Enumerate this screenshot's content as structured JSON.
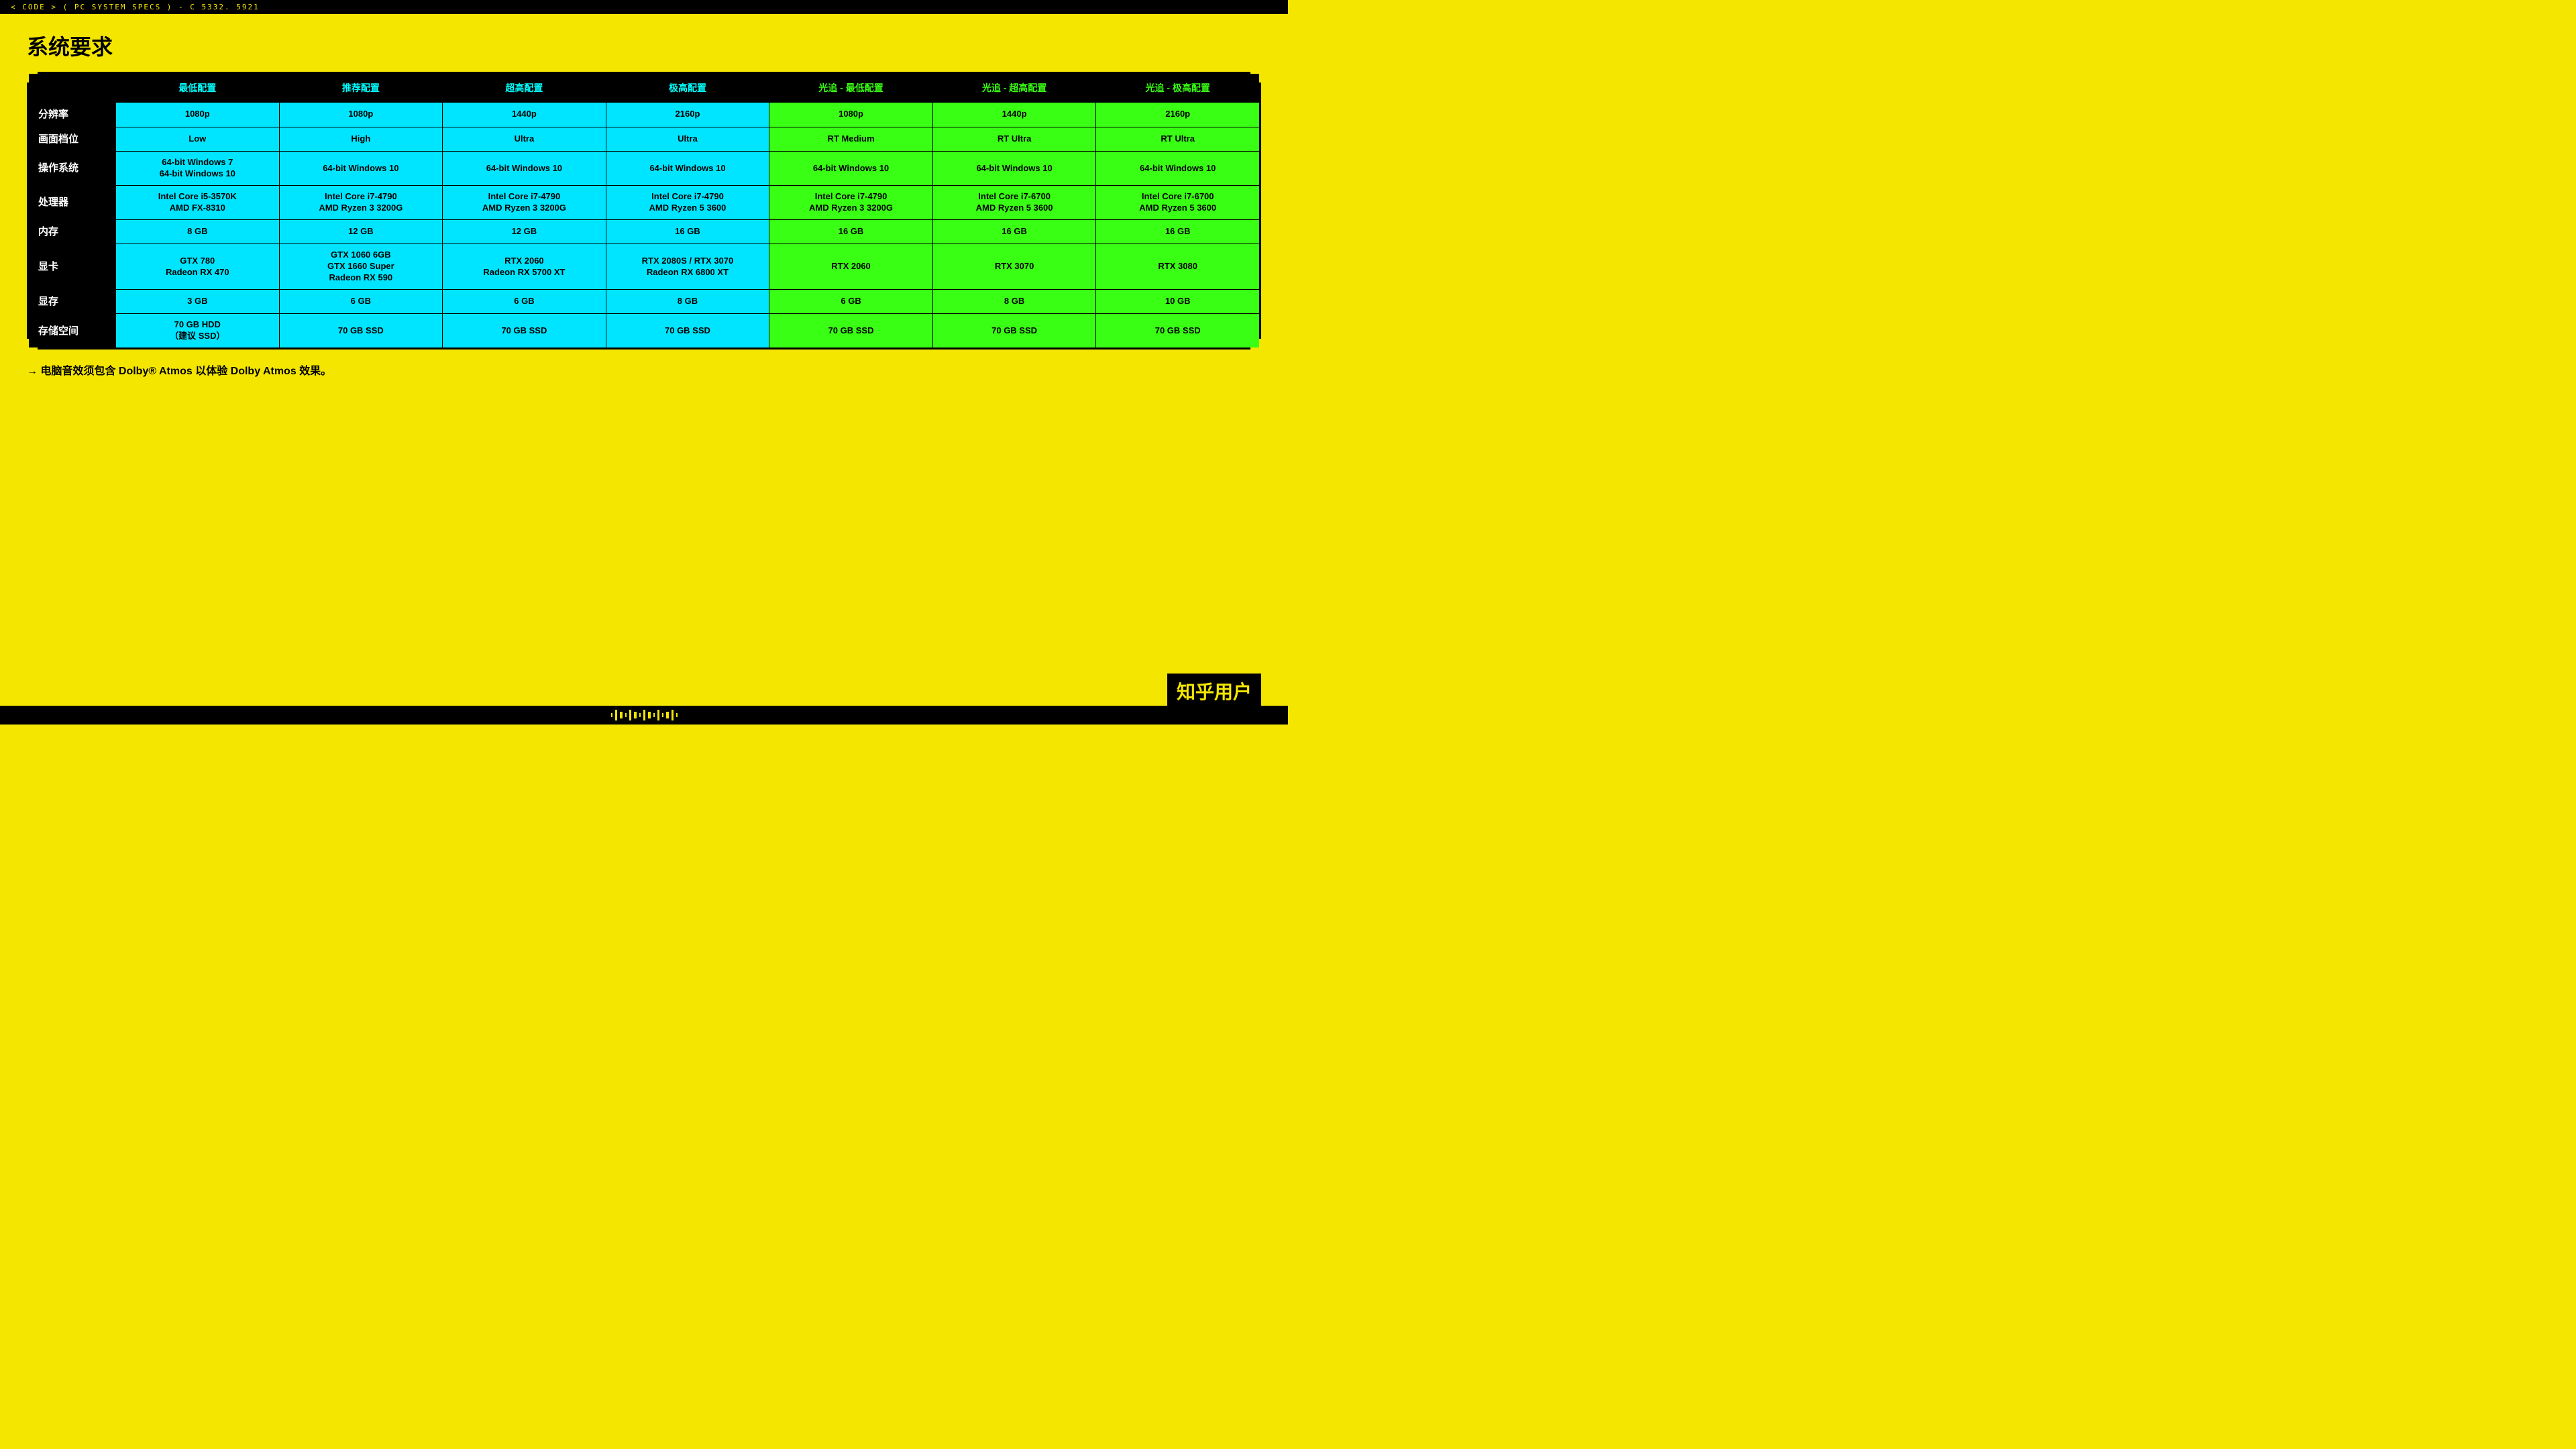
{
  "topbar": {
    "text": "< CODE > ( PC SYSTEM SPECS ) - C 5332. 5921"
  },
  "page_title": "系统要求",
  "table": {
    "headers": [
      {
        "label": "",
        "type": "black"
      },
      {
        "label": "最低配置",
        "type": "cyan"
      },
      {
        "label": "推荐配置",
        "type": "cyan"
      },
      {
        "label": "超高配置",
        "type": "cyan"
      },
      {
        "label": "极高配置",
        "type": "cyan"
      },
      {
        "label": "光追 - 最低配置",
        "type": "green"
      },
      {
        "label": "光追 - 超高配置",
        "type": "green"
      },
      {
        "label": "光追 - 极高配置",
        "type": "green"
      }
    ],
    "rows": [
      {
        "label": "分辨率",
        "cells": [
          {
            "value": "1080p",
            "type": "cyan"
          },
          {
            "value": "1080p",
            "type": "cyan"
          },
          {
            "value": "1440p",
            "type": "cyan"
          },
          {
            "value": "2160p",
            "type": "cyan"
          },
          {
            "value": "1080p",
            "type": "green"
          },
          {
            "value": "1440p",
            "type": "green"
          },
          {
            "value": "2160p",
            "type": "green"
          }
        ]
      },
      {
        "label": "画面档位",
        "cells": [
          {
            "value": "Low",
            "type": "cyan"
          },
          {
            "value": "High",
            "type": "cyan"
          },
          {
            "value": "Ultra",
            "type": "cyan"
          },
          {
            "value": "Ultra",
            "type": "cyan"
          },
          {
            "value": "RT Medium",
            "type": "green"
          },
          {
            "value": "RT Ultra",
            "type": "green"
          },
          {
            "value": "RT Ultra",
            "type": "green"
          }
        ]
      },
      {
        "label": "操作系统",
        "cells": [
          {
            "value": "64-bit Windows 7\n64-bit Windows 10",
            "type": "cyan"
          },
          {
            "value": "64-bit Windows 10",
            "type": "cyan"
          },
          {
            "value": "64-bit Windows 10",
            "type": "cyan"
          },
          {
            "value": "64-bit Windows 10",
            "type": "cyan"
          },
          {
            "value": "64-bit Windows 10",
            "type": "green"
          },
          {
            "value": "64-bit Windows 10",
            "type": "green"
          },
          {
            "value": "64-bit Windows 10",
            "type": "green"
          }
        ]
      },
      {
        "label": "处理器",
        "cells": [
          {
            "value": "Intel Core i5-3570K\nAMD FX-8310",
            "type": "cyan"
          },
          {
            "value": "Intel Core i7-4790\nAMD Ryzen 3 3200G",
            "type": "cyan"
          },
          {
            "value": "Intel Core i7-4790\nAMD Ryzen 3 3200G",
            "type": "cyan"
          },
          {
            "value": "Intel Core i7-4790\nAMD Ryzen 5 3600",
            "type": "cyan"
          },
          {
            "value": "Intel Core i7-4790\nAMD Ryzen 3 3200G",
            "type": "green"
          },
          {
            "value": "Intel Core i7-6700\nAMD Ryzen 5 3600",
            "type": "green"
          },
          {
            "value": "Intel Core i7-6700\nAMD Ryzen 5 3600",
            "type": "green"
          }
        ]
      },
      {
        "label": "内存",
        "cells": [
          {
            "value": "8 GB",
            "type": "cyan"
          },
          {
            "value": "12 GB",
            "type": "cyan"
          },
          {
            "value": "12 GB",
            "type": "cyan"
          },
          {
            "value": "16 GB",
            "type": "cyan"
          },
          {
            "value": "16 GB",
            "type": "green"
          },
          {
            "value": "16 GB",
            "type": "green"
          },
          {
            "value": "16 GB",
            "type": "green"
          }
        ]
      },
      {
        "label": "显卡",
        "cells": [
          {
            "value": "GTX 780\nRadeon RX 470",
            "type": "cyan"
          },
          {
            "value": "GTX 1060 6GB\nGTX 1660 Super\nRadeon RX 590",
            "type": "cyan"
          },
          {
            "value": "RTX 2060\nRadeon RX 5700 XT",
            "type": "cyan"
          },
          {
            "value": "RTX 2080S / RTX 3070\nRadeon RX 6800 XT",
            "type": "cyan"
          },
          {
            "value": "RTX 2060",
            "type": "green"
          },
          {
            "value": "RTX 3070",
            "type": "green"
          },
          {
            "value": "RTX 3080",
            "type": "green"
          }
        ]
      },
      {
        "label": "显存",
        "cells": [
          {
            "value": "3 GB",
            "type": "cyan"
          },
          {
            "value": "6 GB",
            "type": "cyan"
          },
          {
            "value": "6 GB",
            "type": "cyan"
          },
          {
            "value": "8 GB",
            "type": "cyan"
          },
          {
            "value": "6 GB",
            "type": "green"
          },
          {
            "value": "8 GB",
            "type": "green"
          },
          {
            "value": "10 GB",
            "type": "green"
          }
        ]
      },
      {
        "label": "存储空间",
        "cells": [
          {
            "value": "70 GB HDD\n（建议 SSD）",
            "type": "cyan"
          },
          {
            "value": "70 GB SSD",
            "type": "cyan"
          },
          {
            "value": "70 GB SSD",
            "type": "cyan"
          },
          {
            "value": "70 GB SSD",
            "type": "cyan"
          },
          {
            "value": "70 GB SSD",
            "type": "green"
          },
          {
            "value": "70 GB SSD",
            "type": "green"
          },
          {
            "value": "70 GB SSD",
            "type": "green"
          }
        ]
      }
    ]
  },
  "note": "→ 电脑音效须包含 Dolby® Atmos 以体验 Dolby Atmos 效果。",
  "logo": "知乎用户"
}
